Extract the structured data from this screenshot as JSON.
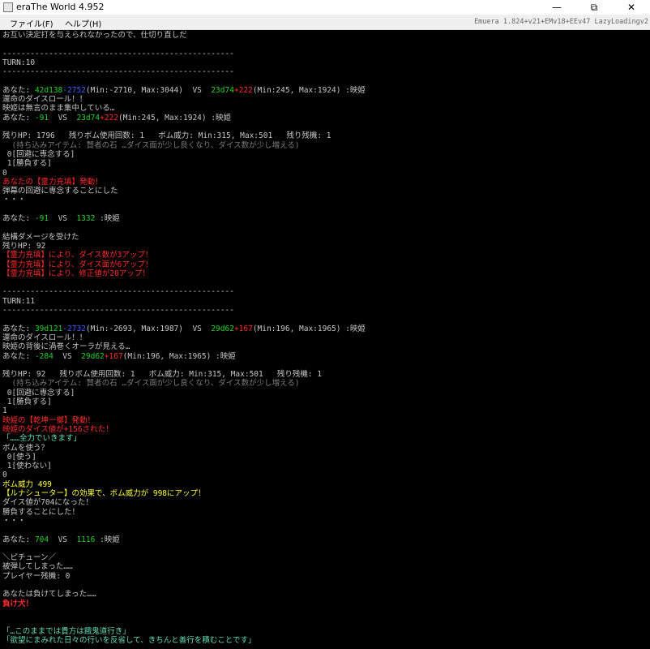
{
  "window": {
    "title": "eraThe World 4.952",
    "minimize": "—",
    "maximize": "⧉",
    "close": "✕"
  },
  "menu": {
    "file": "ファイル(F)",
    "help": "ヘルプ(H)",
    "version": "Emuera 1.824+v21+EMv18+EEv47 LazyLoadingv2"
  },
  "log": [
    [
      {
        "t": "お互い決定打を与えられなかったので、仕切り直しだ",
        "c": "w"
      }
    ],
    [],
    [
      {
        "t": "--------------------------------------------------",
        "c": "w"
      }
    ],
    [
      {
        "t": "TURN:10",
        "c": "w"
      }
    ],
    [
      {
        "t": "--------------------------------------------------",
        "c": "w"
      }
    ],
    [],
    [
      {
        "t": "あなた: ",
        "c": "w"
      },
      {
        "t": "42d138",
        "c": "g"
      },
      {
        "t": "-2752",
        "c": "b"
      },
      {
        "t": "(Min:-2710, Max:3044)  VS  ",
        "c": "w"
      },
      {
        "t": "23d74",
        "c": "g"
      },
      {
        "t": "+222",
        "c": "r"
      },
      {
        "t": "(Min:245, Max:1924) :映姫",
        "c": "w"
      }
    ],
    [
      {
        "t": "運命のダイスロール！！",
        "c": "w"
      }
    ],
    [
      {
        "t": "映姫は無言のまま集中している…",
        "c": "w"
      }
    ],
    [
      {
        "t": "あなた: ",
        "c": "w"
      },
      {
        "t": "-91",
        "c": "g"
      },
      {
        "t": "  VS  ",
        "c": "w"
      },
      {
        "t": "23d74",
        "c": "g"
      },
      {
        "t": "+222",
        "c": "r"
      },
      {
        "t": "(Min:245, Max:1924) :映姫",
        "c": "w"
      }
    ],
    [],
    [
      {
        "t": "残りHP: 1796   残りボム使用回数: 1   ボム威力: Min:315, Max:501   残り残機: 1",
        "c": "w"
      }
    ],
    [
      {
        "t": "  (持ち込みアイテム: 賢者の石 …ダイス面が少し良くなり、ダイス数が少し増える)",
        "c": "gray"
      }
    ],
    [
      {
        "t": " 0[回避に専念する]",
        "c": "w"
      }
    ],
    [
      {
        "t": " 1[勝負する]",
        "c": "w"
      }
    ],
    [
      {
        "t": "0",
        "c": "w"
      }
    ],
    [
      {
        "t": "あなたの【霊力充填】発動！",
        "c": "r"
      }
    ],
    [
      {
        "t": "弾幕の回避に専念することにした",
        "c": "w"
      }
    ],
    [
      {
        "t": "・・・",
        "c": "w"
      }
    ],
    [],
    [
      {
        "t": "あなた: ",
        "c": "w"
      },
      {
        "t": "-91",
        "c": "g"
      },
      {
        "t": "  VS  ",
        "c": "w"
      },
      {
        "t": "1332",
        "c": "g"
      },
      {
        "t": " :映姫",
        "c": "w"
      }
    ],
    [],
    [
      {
        "t": "結構ダメージを受けた",
        "c": "w"
      }
    ],
    [
      {
        "t": "残りHP: 92",
        "c": "w"
      }
    ],
    [
      {
        "t": "【霊力充填】により、ダイス数が3アップ！",
        "c": "r"
      }
    ],
    [
      {
        "t": "【霊力充填】により、ダイス面が6アップ！",
        "c": "r"
      }
    ],
    [
      {
        "t": "【霊力充填】により、修正値が20アップ！",
        "c": "r"
      }
    ],
    [],
    [
      {
        "t": "--------------------------------------------------",
        "c": "w"
      }
    ],
    [
      {
        "t": "TURN:11",
        "c": "w"
      }
    ],
    [
      {
        "t": "--------------------------------------------------",
        "c": "w"
      }
    ],
    [],
    [
      {
        "t": "あなた: ",
        "c": "w"
      },
      {
        "t": "39d121",
        "c": "g"
      },
      {
        "t": "-2732",
        "c": "b"
      },
      {
        "t": "(Min:-2693, Max:1987)  VS  ",
        "c": "w"
      },
      {
        "t": "29d62",
        "c": "g"
      },
      {
        "t": "+167",
        "c": "r"
      },
      {
        "t": "(Min:196, Max:1965) :映姫",
        "c": "w"
      }
    ],
    [
      {
        "t": "運命のダイスロール！！",
        "c": "w"
      }
    ],
    [
      {
        "t": "映姫の背後に渦巻くオーラが見える…",
        "c": "w"
      }
    ],
    [
      {
        "t": "あなた: ",
        "c": "w"
      },
      {
        "t": "-284",
        "c": "g"
      },
      {
        "t": "  VS  ",
        "c": "w"
      },
      {
        "t": "29d62",
        "c": "g"
      },
      {
        "t": "+167",
        "c": "r"
      },
      {
        "t": "(Min:196, Max:1965) :映姫",
        "c": "w"
      }
    ],
    [],
    [
      {
        "t": "残りHP: 92   残りボム使用回数: 1   ボム威力: Min:315, Max:501   残り残機: 1",
        "c": "w"
      }
    ],
    [
      {
        "t": "  (持ち込みアイテム: 賢者の石 …ダイス面が少し良くなり、ダイス数が少し増える)",
        "c": "gray"
      }
    ],
    [
      {
        "t": " 0[回避に専念する]",
        "c": "w"
      }
    ],
    [
      {
        "t": " 1[勝負する]",
        "c": "w"
      }
    ],
    [
      {
        "t": "1",
        "c": "w"
      }
    ],
    [
      {
        "t": "映姫の【乾坤一擲】発動！",
        "c": "r"
      }
    ],
    [
      {
        "t": "映姫のダイス値が+156された！",
        "c": "r"
      }
    ],
    [
      {
        "t": "「……全力でいきます」",
        "c": "teal"
      }
    ],
    [
      {
        "t": "ボムを使う？",
        "c": "w"
      }
    ],
    [
      {
        "t": " 0[使う]",
        "c": "w"
      }
    ],
    [
      {
        "t": " 1[使わない]",
        "c": "w"
      }
    ],
    [
      {
        "t": "0",
        "c": "w"
      }
    ],
    [
      {
        "t": "ボム威力 499",
        "c": "y"
      }
    ],
    [
      {
        "t": "【ルナシューター】",
        "c": "y"
      },
      {
        "t": "の効果で、ボム威力が 998にアップ！",
        "c": "y"
      }
    ],
    [
      {
        "t": "ダイス値が704になった！",
        "c": "w"
      }
    ],
    [
      {
        "t": "勝負することにした！",
        "c": "w"
      }
    ],
    [
      {
        "t": "・・・",
        "c": "w"
      }
    ],
    [],
    [
      {
        "t": "あなた: ",
        "c": "w"
      },
      {
        "t": "704",
        "c": "g"
      },
      {
        "t": "  VS  ",
        "c": "w"
      },
      {
        "t": "1116",
        "c": "g"
      },
      {
        "t": " :映姫",
        "c": "w"
      }
    ],
    [],
    [
      {
        "t": "＼ピチューン／",
        "c": "w"
      }
    ],
    [
      {
        "t": "被弾してしまった……",
        "c": "w"
      }
    ],
    [
      {
        "t": "プレイヤー残機: 0",
        "c": "w"
      }
    ],
    [],
    [
      {
        "t": "あなたは負けてしまった……",
        "c": "w"
      }
    ],
    [
      {
        "t": "負け犬！",
        "c": "r",
        "bold": true
      }
    ],
    [],
    [],
    [
      {
        "t": "「…このままでは貴方は餓鬼道行き」",
        "c": "teal"
      }
    ],
    [
      {
        "t": "「欲望にまみれた日々の行いを反省して、きちんと善行を積むことです」",
        "c": "teal"
      }
    ]
  ]
}
